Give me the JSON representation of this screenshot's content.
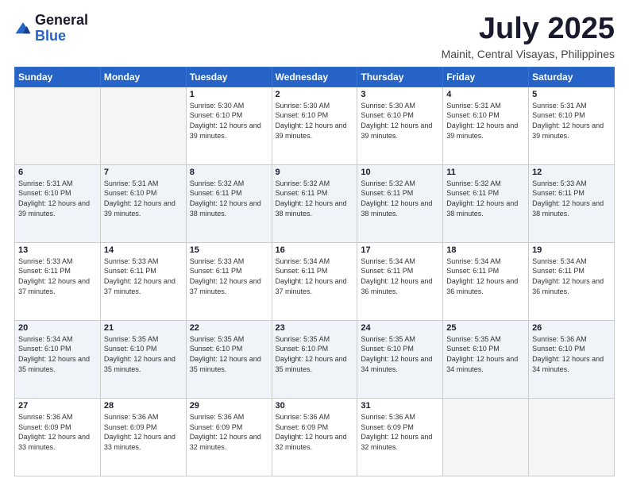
{
  "logo": {
    "general": "General",
    "blue": "Blue"
  },
  "header": {
    "month": "July 2025",
    "location": "Mainit, Central Visayas, Philippines"
  },
  "weekdays": [
    "Sunday",
    "Monday",
    "Tuesday",
    "Wednesday",
    "Thursday",
    "Friday",
    "Saturday"
  ],
  "weeks": [
    [
      {
        "day": "",
        "info": ""
      },
      {
        "day": "",
        "info": ""
      },
      {
        "day": "1",
        "info": "Sunrise: 5:30 AM\nSunset: 6:10 PM\nDaylight: 12 hours and 39 minutes."
      },
      {
        "day": "2",
        "info": "Sunrise: 5:30 AM\nSunset: 6:10 PM\nDaylight: 12 hours and 39 minutes."
      },
      {
        "day": "3",
        "info": "Sunrise: 5:30 AM\nSunset: 6:10 PM\nDaylight: 12 hours and 39 minutes."
      },
      {
        "day": "4",
        "info": "Sunrise: 5:31 AM\nSunset: 6:10 PM\nDaylight: 12 hours and 39 minutes."
      },
      {
        "day": "5",
        "info": "Sunrise: 5:31 AM\nSunset: 6:10 PM\nDaylight: 12 hours and 39 minutes."
      }
    ],
    [
      {
        "day": "6",
        "info": "Sunrise: 5:31 AM\nSunset: 6:10 PM\nDaylight: 12 hours and 39 minutes."
      },
      {
        "day": "7",
        "info": "Sunrise: 5:31 AM\nSunset: 6:10 PM\nDaylight: 12 hours and 39 minutes."
      },
      {
        "day": "8",
        "info": "Sunrise: 5:32 AM\nSunset: 6:11 PM\nDaylight: 12 hours and 38 minutes."
      },
      {
        "day": "9",
        "info": "Sunrise: 5:32 AM\nSunset: 6:11 PM\nDaylight: 12 hours and 38 minutes."
      },
      {
        "day": "10",
        "info": "Sunrise: 5:32 AM\nSunset: 6:11 PM\nDaylight: 12 hours and 38 minutes."
      },
      {
        "day": "11",
        "info": "Sunrise: 5:32 AM\nSunset: 6:11 PM\nDaylight: 12 hours and 38 minutes."
      },
      {
        "day": "12",
        "info": "Sunrise: 5:33 AM\nSunset: 6:11 PM\nDaylight: 12 hours and 38 minutes."
      }
    ],
    [
      {
        "day": "13",
        "info": "Sunrise: 5:33 AM\nSunset: 6:11 PM\nDaylight: 12 hours and 37 minutes."
      },
      {
        "day": "14",
        "info": "Sunrise: 5:33 AM\nSunset: 6:11 PM\nDaylight: 12 hours and 37 minutes."
      },
      {
        "day": "15",
        "info": "Sunrise: 5:33 AM\nSunset: 6:11 PM\nDaylight: 12 hours and 37 minutes."
      },
      {
        "day": "16",
        "info": "Sunrise: 5:34 AM\nSunset: 6:11 PM\nDaylight: 12 hours and 37 minutes."
      },
      {
        "day": "17",
        "info": "Sunrise: 5:34 AM\nSunset: 6:11 PM\nDaylight: 12 hours and 36 minutes."
      },
      {
        "day": "18",
        "info": "Sunrise: 5:34 AM\nSunset: 6:11 PM\nDaylight: 12 hours and 36 minutes."
      },
      {
        "day": "19",
        "info": "Sunrise: 5:34 AM\nSunset: 6:11 PM\nDaylight: 12 hours and 36 minutes."
      }
    ],
    [
      {
        "day": "20",
        "info": "Sunrise: 5:34 AM\nSunset: 6:10 PM\nDaylight: 12 hours and 35 minutes."
      },
      {
        "day": "21",
        "info": "Sunrise: 5:35 AM\nSunset: 6:10 PM\nDaylight: 12 hours and 35 minutes."
      },
      {
        "day": "22",
        "info": "Sunrise: 5:35 AM\nSunset: 6:10 PM\nDaylight: 12 hours and 35 minutes."
      },
      {
        "day": "23",
        "info": "Sunrise: 5:35 AM\nSunset: 6:10 PM\nDaylight: 12 hours and 35 minutes."
      },
      {
        "day": "24",
        "info": "Sunrise: 5:35 AM\nSunset: 6:10 PM\nDaylight: 12 hours and 34 minutes."
      },
      {
        "day": "25",
        "info": "Sunrise: 5:35 AM\nSunset: 6:10 PM\nDaylight: 12 hours and 34 minutes."
      },
      {
        "day": "26",
        "info": "Sunrise: 5:36 AM\nSunset: 6:10 PM\nDaylight: 12 hours and 34 minutes."
      }
    ],
    [
      {
        "day": "27",
        "info": "Sunrise: 5:36 AM\nSunset: 6:09 PM\nDaylight: 12 hours and 33 minutes."
      },
      {
        "day": "28",
        "info": "Sunrise: 5:36 AM\nSunset: 6:09 PM\nDaylight: 12 hours and 33 minutes."
      },
      {
        "day": "29",
        "info": "Sunrise: 5:36 AM\nSunset: 6:09 PM\nDaylight: 12 hours and 32 minutes."
      },
      {
        "day": "30",
        "info": "Sunrise: 5:36 AM\nSunset: 6:09 PM\nDaylight: 12 hours and 32 minutes."
      },
      {
        "day": "31",
        "info": "Sunrise: 5:36 AM\nSunset: 6:09 PM\nDaylight: 12 hours and 32 minutes."
      },
      {
        "day": "",
        "info": ""
      },
      {
        "day": "",
        "info": ""
      }
    ]
  ]
}
